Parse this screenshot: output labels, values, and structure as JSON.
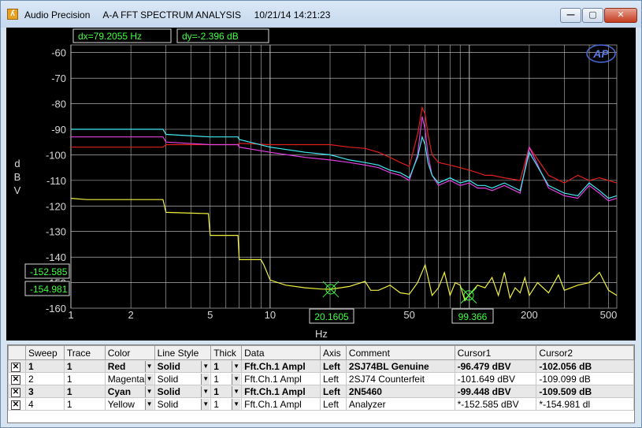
{
  "window": {
    "title": "Audio Precision     A-A FFT SPECTRUM ANALYSIS     10/21/14 14:21:23",
    "min_label": "—",
    "max_label": "▢",
    "close_label": "✕"
  },
  "readouts": {
    "dx": "dx=79.2055  Hz",
    "dy": "dy=-2.396  dB",
    "cursor1_y": "-152.585",
    "cursor2_y": "-154.981",
    "cursor1_x": "20.1605",
    "cursor2_x": "99.366"
  },
  "logo": "AP",
  "colors": {
    "red": "#e0201c",
    "magenta": "#e040e0",
    "cyan": "#40e8f0",
    "yellow": "#f0f040",
    "grid": "#d0d0d0",
    "readout": "#40ff40"
  },
  "chart_data": {
    "type": "line",
    "title": "",
    "xlabel": "Hz",
    "ylabel": "dBV",
    "x_scale": "log",
    "xlim": [
      1,
      550
    ],
    "ylim": [
      -160,
      -57
    ],
    "x_ticks": [
      "1",
      "2",
      "5",
      "10",
      "20",
      "50",
      "100",
      "200",
      "500"
    ],
    "y_ticks": [
      "-60",
      "-70",
      "-80",
      "-90",
      "-100",
      "-110",
      "-120",
      "-130",
      "-140",
      "-150",
      "-160"
    ],
    "grid": true,
    "series": [
      {
        "name": "Red",
        "color": "red",
        "x": [
          1,
          2.9,
          3,
          5,
          6.9,
          7,
          10,
          15,
          20,
          25,
          30,
          35,
          40,
          45,
          50,
          55,
          58,
          60,
          62,
          65,
          70,
          80,
          90,
          100,
          110,
          120,
          130,
          150,
          180,
          200,
          250,
          300,
          350,
          400,
          450,
          500,
          550
        ],
        "y": [
          -97,
          -97,
          -96,
          -96,
          -96,
          -95.5,
          -96,
          -96,
          -96,
          -97,
          -97.5,
          -99,
          -101,
          -103,
          -104.5,
          -92,
          -81.5,
          -84,
          -92,
          -100,
          -103,
          -104,
          -105,
          -106,
          -107,
          -108,
          -108,
          -109,
          -110,
          -97,
          -108,
          -111,
          -108,
          -110,
          -109,
          -110,
          -111
        ]
      },
      {
        "name": "Magenta",
        "color": "magenta",
        "x": [
          1,
          2.9,
          3,
          5,
          6.9,
          7,
          10,
          15,
          20,
          25,
          30,
          35,
          40,
          45,
          50,
          55,
          58,
          60,
          62,
          65,
          70,
          80,
          90,
          100,
          110,
          120,
          130,
          150,
          180,
          200,
          250,
          300,
          350,
          400,
          450,
          500,
          550
        ],
        "y": [
          -93,
          -93,
          -95,
          -96,
          -96,
          -97,
          -99,
          -101,
          -102,
          -103,
          -104,
          -105,
          -107,
          -108,
          -110,
          -100,
          -85,
          -90,
          -100,
          -108,
          -112,
          -110,
          -112,
          -111,
          -113,
          -113,
          -114,
          -112,
          -115,
          -97,
          -113,
          -116,
          -117,
          -112,
          -115,
          -118,
          -117
        ]
      },
      {
        "name": "Cyan",
        "color": "cyan",
        "x": [
          1,
          2.9,
          3,
          5,
          6.9,
          7,
          10,
          15,
          20,
          25,
          30,
          35,
          40,
          45,
          50,
          55,
          58,
          60,
          62,
          65,
          70,
          80,
          90,
          100,
          110,
          120,
          130,
          150,
          180,
          200,
          250,
          300,
          350,
          400,
          450,
          500,
          550
        ],
        "y": [
          -90,
          -90,
          -92,
          -93,
          -93,
          -94,
          -97,
          -99,
          -100,
          -102,
          -103,
          -104,
          -106,
          -107,
          -109,
          -101,
          -93,
          -96,
          -103,
          -108,
          -111,
          -109,
          -111,
          -110,
          -112,
          -112,
          -113,
          -111,
          -114,
          -99,
          -112,
          -115,
          -116,
          -111,
          -114,
          -117,
          -116
        ]
      },
      {
        "name": "Yellow",
        "color": "yellow",
        "x": [
          1,
          1.2,
          2.9,
          3,
          4.9,
          5,
          6.9,
          7,
          9,
          9.3,
          10,
          12,
          15,
          18,
          20.16,
          25,
          30,
          32,
          35,
          40,
          45,
          50,
          55,
          60,
          65,
          70,
          75,
          80,
          85,
          90,
          95,
          99.37,
          110,
          120,
          130,
          140,
          150,
          160,
          170,
          180,
          190,
          200,
          220,
          250,
          280,
          300,
          350,
          400,
          450,
          500,
          550
        ],
        "y": [
          -117,
          -117.5,
          -117.5,
          -122.5,
          -123,
          -131.5,
          -131.5,
          -141,
          -141,
          -143,
          -149,
          -151,
          -152,
          -152.5,
          -152.6,
          -151.5,
          -149.5,
          -153,
          -153,
          -151,
          -154,
          -154.5,
          -150,
          -143,
          -155,
          -152,
          -146,
          -155,
          -150,
          -151,
          -157,
          -155,
          -151,
          -152,
          -148,
          -155,
          -146,
          -156,
          -152,
          -154,
          -148,
          -155,
          -150,
          -154,
          -147,
          -153,
          -151,
          -150,
          -146,
          -153,
          -155
        ]
      }
    ],
    "cursors": [
      {
        "x": 20.1605,
        "y": -152.585
      },
      {
        "x": 99.366,
        "y": -154.981
      }
    ]
  },
  "table": {
    "headers": [
      "",
      "Sweep",
      "Trace",
      "Color",
      "Line Style",
      "Thick",
      "Data",
      "Axis",
      "Comment",
      "Cursor1",
      "Cursor2"
    ],
    "rows": [
      {
        "check": "✕",
        "sweep": "1",
        "trace": "1",
        "color": "Red",
        "style": "Solid",
        "thick": "1",
        "data": "Fft.Ch.1 Ampl",
        "axis": "Left",
        "comment": "2SJ74BL Genuine",
        "c1": "-96.479  dBV",
        "c2": "-102.056  dB"
      },
      {
        "check": "✕",
        "sweep": "2",
        "trace": "1",
        "color": "Magenta",
        "style": "Solid",
        "thick": "1",
        "data": "Fft.Ch.1 Ampl",
        "axis": "Left",
        "comment": "2SJ74 Counterfeit",
        "c1": "-101.649  dBV",
        "c2": "-109.099  dB"
      },
      {
        "check": "✕",
        "sweep": "3",
        "trace": "1",
        "color": "Cyan",
        "style": "Solid",
        "thick": "1",
        "data": "Fft.Ch.1 Ampl",
        "axis": "Left",
        "comment": "2N5460",
        "c1": "-99.448  dBV",
        "c2": "-109.509  dB"
      },
      {
        "check": "✕",
        "sweep": "4",
        "trace": "1",
        "color": "Yellow",
        "style": "Solid",
        "thick": "1",
        "data": "Fft.Ch.1 Ampl",
        "axis": "Left",
        "comment": "Analyzer",
        "c1": "*-152.585  dBV",
        "c2": "*-154.981  dl"
      }
    ]
  }
}
